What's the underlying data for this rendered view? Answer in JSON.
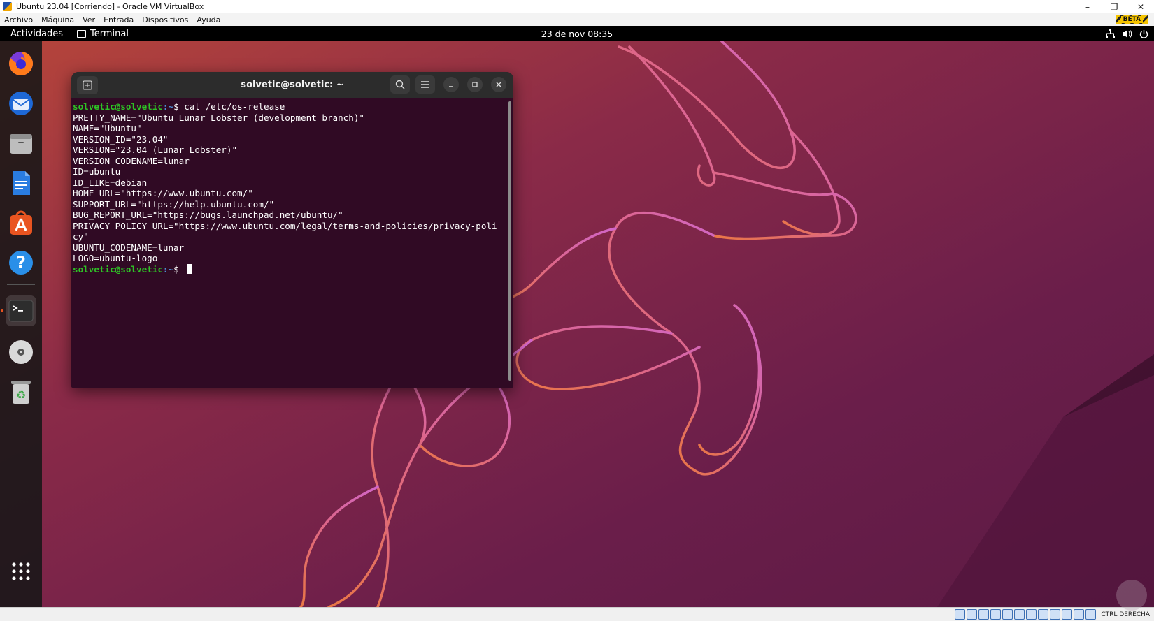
{
  "vbox": {
    "window_title": "Ubuntu 23.04 [Corriendo] - Oracle VM VirtualBox",
    "menu": [
      "Archivo",
      "Máquina",
      "Ver",
      "Entrada",
      "Dispositivos",
      "Ayuda"
    ],
    "badge": "BETA",
    "host_key": "CTRL DERECHA"
  },
  "topbar": {
    "activities": "Actividades",
    "app_name": "Terminal",
    "clock": "23 de nov  08:35"
  },
  "dock": {
    "items": [
      "firefox-icon",
      "thunderbird-icon",
      "files-icon",
      "libreoffice-writer-icon",
      "app-center-icon",
      "help-icon",
      "terminal-icon",
      "optical-disc-icon",
      "trash-icon",
      "show-apps-icon"
    ]
  },
  "terminal": {
    "title": "solvetic@solvetic: ~",
    "prompt_user": "solvetic@solvetic",
    "prompt_path": ":~",
    "prompt_sym": "$ ",
    "command": "cat /etc/os-release",
    "output": [
      "PRETTY_NAME=\"Ubuntu Lunar Lobster (development branch)\"",
      "NAME=\"Ubuntu\"",
      "VERSION_ID=\"23.04\"",
      "VERSION=\"23.04 (Lunar Lobster)\"",
      "VERSION_CODENAME=lunar",
      "ID=ubuntu",
      "ID_LIKE=debian",
      "HOME_URL=\"https://www.ubuntu.com/\"",
      "SUPPORT_URL=\"https://help.ubuntu.com/\"",
      "BUG_REPORT_URL=\"https://bugs.launchpad.net/ubuntu/\"",
      "PRIVACY_POLICY_URL=\"https://www.ubuntu.com/legal/terms-and-policies/privacy-poli",
      "cy\"",
      "UBUNTU_CODENAME=lunar",
      "LOGO=ubuntu-logo"
    ]
  },
  "colors": {
    "terminal_bg": "#300a24",
    "prompt_user": "#2ec225",
    "prompt_path": "#4e8fd6",
    "ubuntu_orange": "#e95420"
  }
}
